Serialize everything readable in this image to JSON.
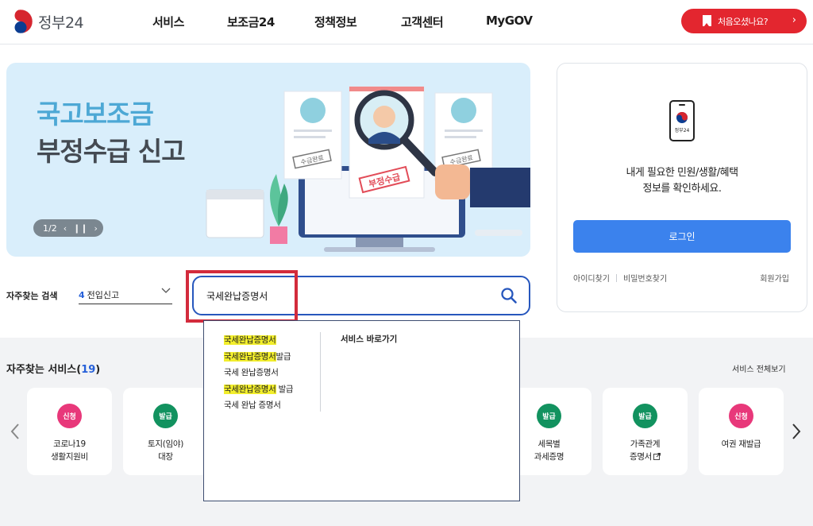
{
  "header": {
    "logo_text": "정부24",
    "nav": [
      "서비스",
      "보조금24",
      "정책정보",
      "고객센터",
      "MyGOV"
    ],
    "first_visit_label": "처음오셨나요?",
    "first_visit_arrow": "›"
  },
  "banner": {
    "title": "국고보조금",
    "subtitle": "부정수급 신고",
    "pager": "1/2",
    "stamp_left": "수급완료",
    "stamp_center": "부정수급",
    "stamp_right": "수급완료"
  },
  "login": {
    "phone_text": "정부24",
    "message_line1": "내게 필요한 민원/생활/혜택",
    "message_line2": "정보를 확인하세요.",
    "button": "로그인",
    "find_id": "아이디찾기",
    "find_pw": "비밀번호찾기",
    "signup": "회원가입"
  },
  "search": {
    "freq_label": "자주찾는 검색",
    "freq_select_num": "4",
    "freq_select_text": "전입신고",
    "value": "국세완납증명서",
    "suggestions": [
      {
        "hl": "국세완납증명서",
        "rest": ""
      },
      {
        "hl": "국세완납증명서",
        "rest": "발급"
      },
      {
        "hl": "",
        "rest": "국세 완납증명서"
      },
      {
        "hl": "국세완납증명서",
        "rest": " 발급"
      },
      {
        "hl": "",
        "rest": "국세 완납 증명서"
      }
    ],
    "shortcut_label": "서비스 바로가기"
  },
  "services": {
    "title": "자주찾는 서비스(",
    "count": "19",
    "title_close": ")",
    "view_all": "서비스 전체보기",
    "cards": [
      {
        "badge": "신청",
        "color": "red",
        "line1": "코로나19",
        "line2": "생활지원비",
        "ext": false
      },
      {
        "badge": "발급",
        "color": "green",
        "line1": "토지(임야)",
        "line2": "대장",
        "ext": false
      },
      {
        "badge": "발급",
        "color": "green",
        "line1": "세목별",
        "line2": "과세증명",
        "ext": false
      },
      {
        "badge": "발급",
        "color": "green",
        "line1": "가족관계",
        "line2": "증명서",
        "ext": true
      },
      {
        "badge": "신청",
        "color": "red",
        "line1": "여권 재발급",
        "line2": "",
        "ext": false
      }
    ]
  },
  "colors": {
    "accent_red": "#e3262f",
    "primary_blue": "#3b82ed",
    "search_border": "#2757bd",
    "highlight_yellow": "#f2ee2c"
  }
}
